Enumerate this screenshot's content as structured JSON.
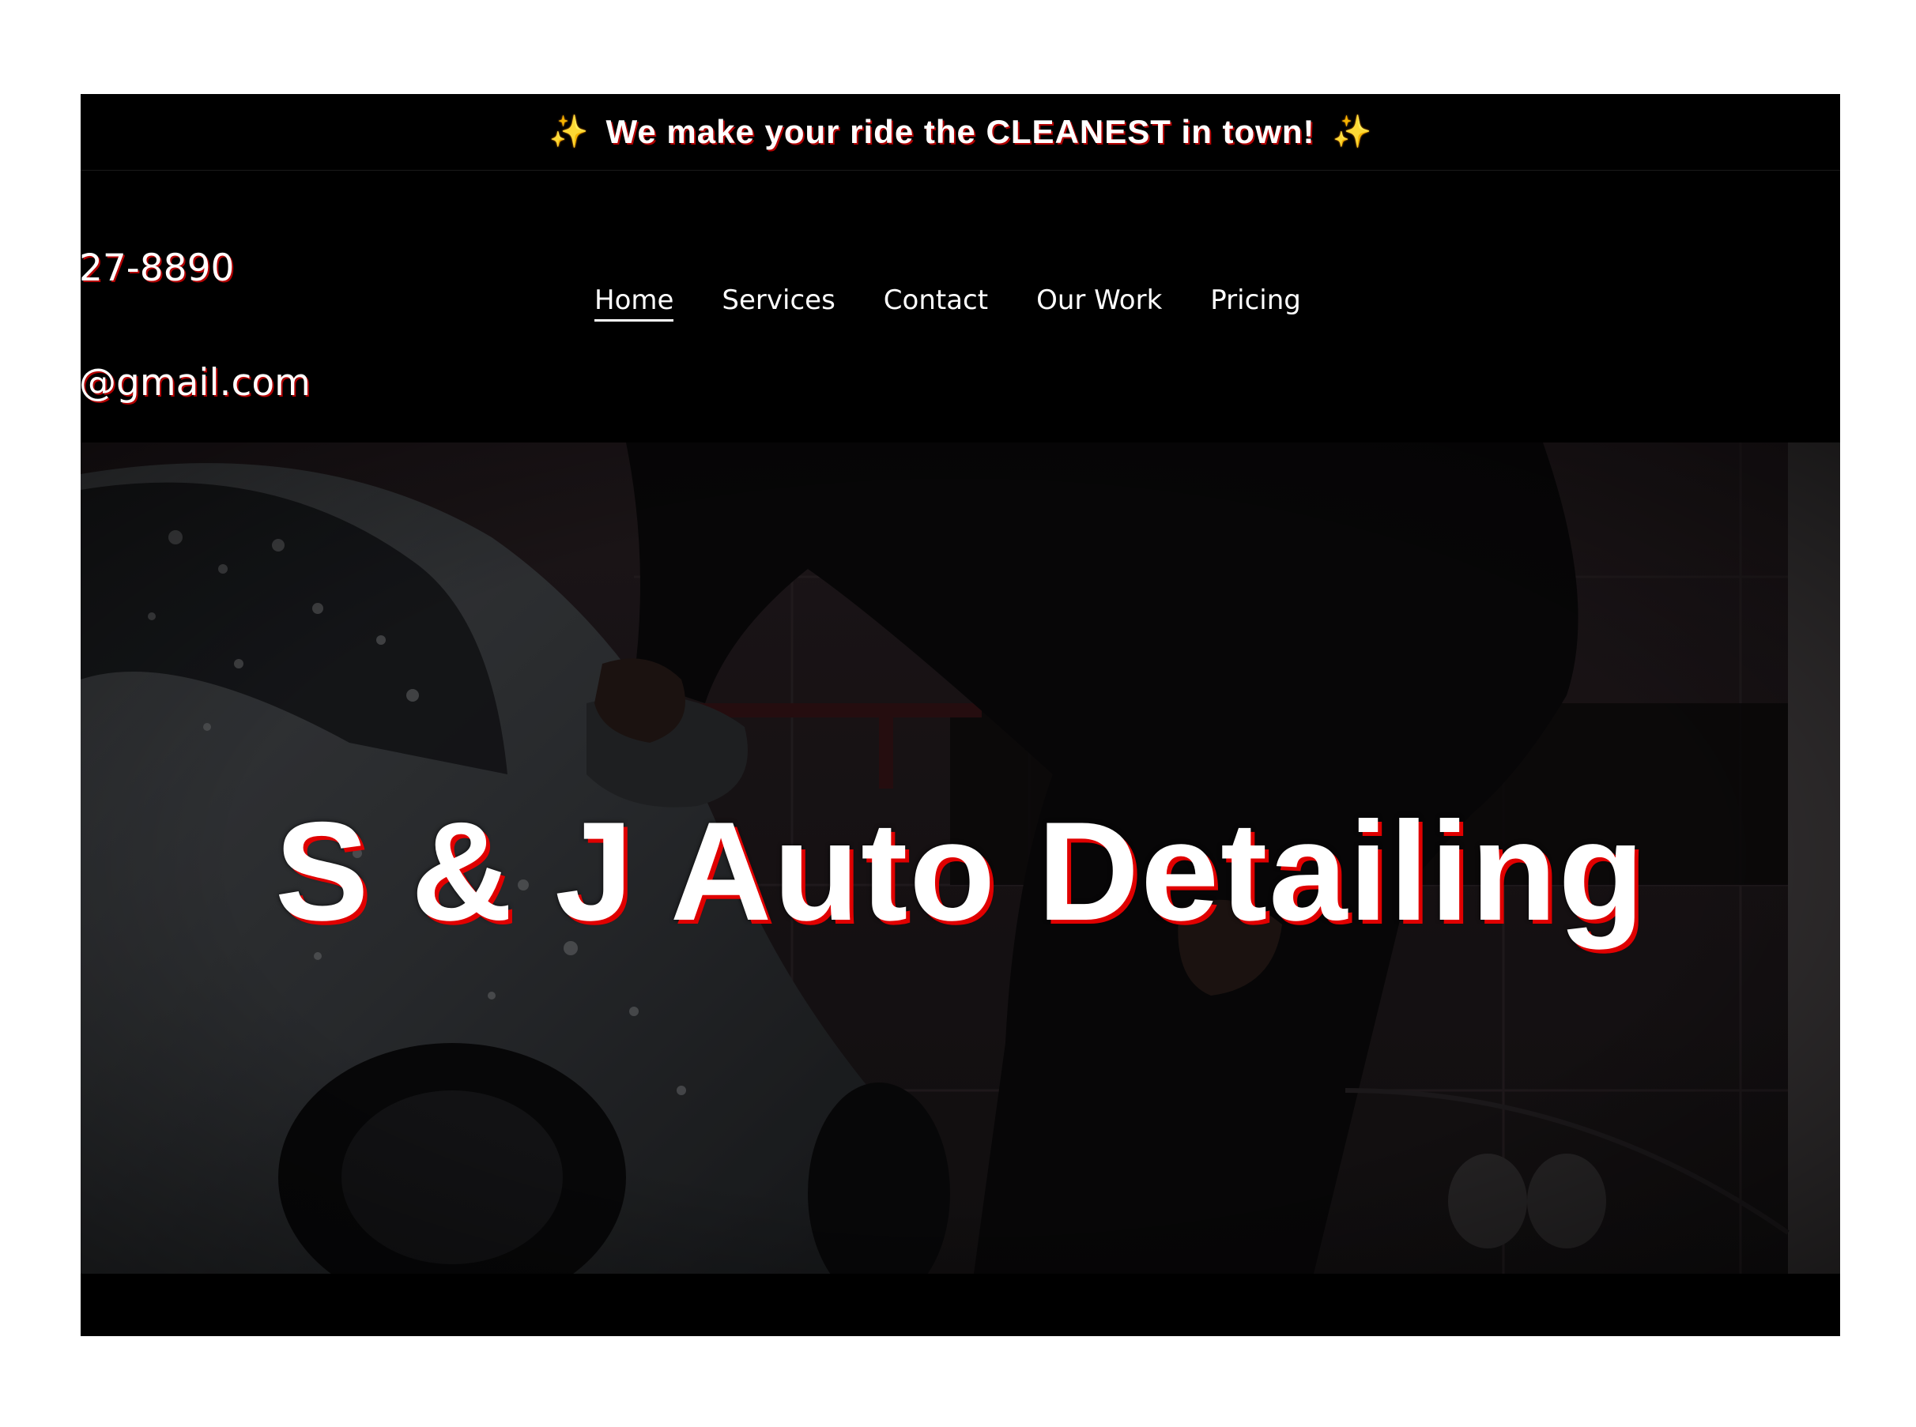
{
  "announcement": {
    "left_icon": "sparkles-icon",
    "text": "We make your ride the CLEANEST in town!",
    "right_icon": "sparkles-icon"
  },
  "header": {
    "phone": "27-8890",
    "email": "@gmail.com"
  },
  "nav": {
    "items": [
      {
        "label": "Home",
        "active": true
      },
      {
        "label": "Services",
        "active": false
      },
      {
        "label": "Contact",
        "active": false
      },
      {
        "label": "Our Work",
        "active": false
      },
      {
        "label": "Pricing",
        "active": false
      }
    ]
  },
  "hero": {
    "title": "S & J Auto Detailing",
    "background": "photo of a person polishing a soapy grey sports car in a garage (darkened overlay)"
  },
  "colors": {
    "background": "#000000",
    "text": "#ffffff",
    "text_shadow": "#e00000",
    "sparkle": "#f5c518"
  }
}
